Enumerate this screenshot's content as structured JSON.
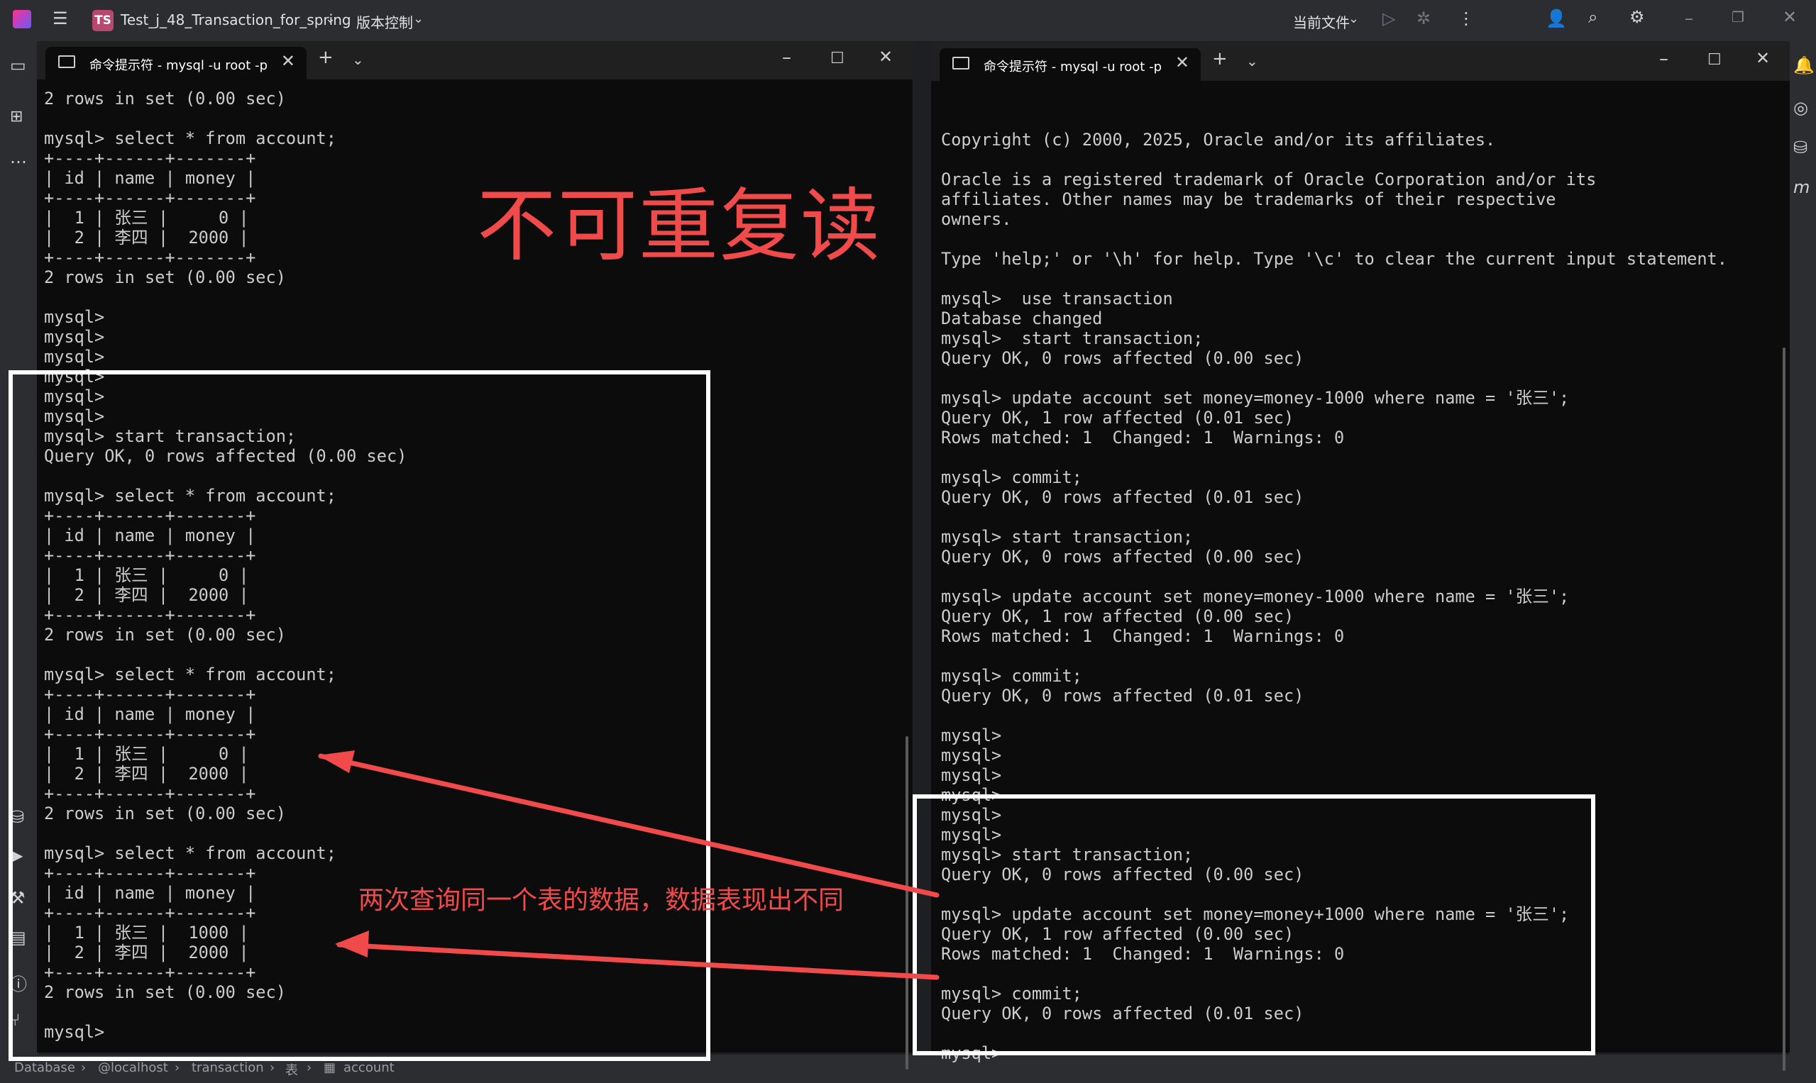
{
  "ide": {
    "project_badge": "TS",
    "project_name": "Test_j_48_Transaction_for_spring",
    "vcs_menu": "版本控制",
    "run_config": "当前文件",
    "status_crumbs": [
      "Database",
      "@localhost",
      "transaction",
      "表",
      "account"
    ]
  },
  "left_terminal": {
    "tab_title": "命令提示符 - mysql  -u root -p",
    "lines": [
      "2 rows in set (0.00 sec)",
      "",
      "mysql> select * from account;",
      "+----+------+-------+",
      "| id | name | money |",
      "+----+------+-------+",
      "|  1 | 张三 |     0 |",
      "|  2 | 李四 |  2000 |",
      "+----+------+-------+",
      "2 rows in set (0.00 sec)",
      "",
      "mysql>",
      "mysql>",
      "mysql>",
      "mysql>",
      "mysql>",
      "mysql>",
      "mysql> start transaction;",
      "Query OK, 0 rows affected (0.00 sec)",
      "",
      "mysql> select * from account;",
      "+----+------+-------+",
      "| id | name | money |",
      "+----+------+-------+",
      "|  1 | 张三 |     0 |",
      "|  2 | 李四 |  2000 |",
      "+----+------+-------+",
      "2 rows in set (0.00 sec)",
      "",
      "mysql> select * from account;",
      "+----+------+-------+",
      "| id | name | money |",
      "+----+------+-------+",
      "|  1 | 张三 |     0 |",
      "|  2 | 李四 |  2000 |",
      "+----+------+-------+",
      "2 rows in set (0.00 sec)",
      "",
      "mysql> select * from account;",
      "+----+------+-------+",
      "| id | name | money |",
      "+----+------+-------+",
      "|  1 | 张三 |  1000 |",
      "|  2 | 李四 |  2000 |",
      "+----+------+-------+",
      "2 rows in set (0.00 sec)",
      "",
      "mysql>"
    ]
  },
  "right_terminal": {
    "tab_title": "命令提示符 - mysql  -u root -p",
    "lines": [
      "",
      "Copyright (c) 2000, 2025, Oracle and/or its affiliates.",
      "",
      "Oracle is a registered trademark of Oracle Corporation and/or its",
      "affiliates. Other names may be trademarks of their respective",
      "owners.",
      "",
      "Type 'help;' or '\\h' for help. Type '\\c' to clear the current input statement.",
      "",
      "mysql>  use transaction",
      "Database changed",
      "mysql>  start transaction;",
      "Query OK, 0 rows affected (0.00 sec)",
      "",
      "mysql> update account set money=money-1000 where name = '张三';",
      "Query OK, 1 row affected (0.01 sec)",
      "Rows matched: 1  Changed: 1  Warnings: 0",
      "",
      "mysql> commit;",
      "Query OK, 0 rows affected (0.01 sec)",
      "",
      "mysql> start transaction;",
      "Query OK, 0 rows affected (0.00 sec)",
      "",
      "mysql> update account set money=money-1000 where name = '张三';",
      "Query OK, 1 row affected (0.00 sec)",
      "Rows matched: 1  Changed: 1  Warnings: 0",
      "",
      "mysql> commit;",
      "Query OK, 0 rows affected (0.01 sec)",
      "",
      "mysql>",
      "mysql>",
      "mysql>",
      "mysql>",
      "mysql>",
      "mysql>",
      "mysql> start transaction;",
      "Query OK, 0 rows affected (0.00 sec)",
      "",
      "mysql> update account set money=money+1000 where name = '张三';",
      "Query OK, 1 row affected (0.00 sec)",
      "Rows matched: 1  Changed: 1  Warnings: 0",
      "",
      "mysql> commit;",
      "Query OK, 0 rows affected (0.01 sec)",
      "",
      "mysql>"
    ]
  },
  "annotations": {
    "title": "不可重复读",
    "note": "两次查询同一个表的数据，数据表现出不同",
    "color": "#f04a4a"
  }
}
